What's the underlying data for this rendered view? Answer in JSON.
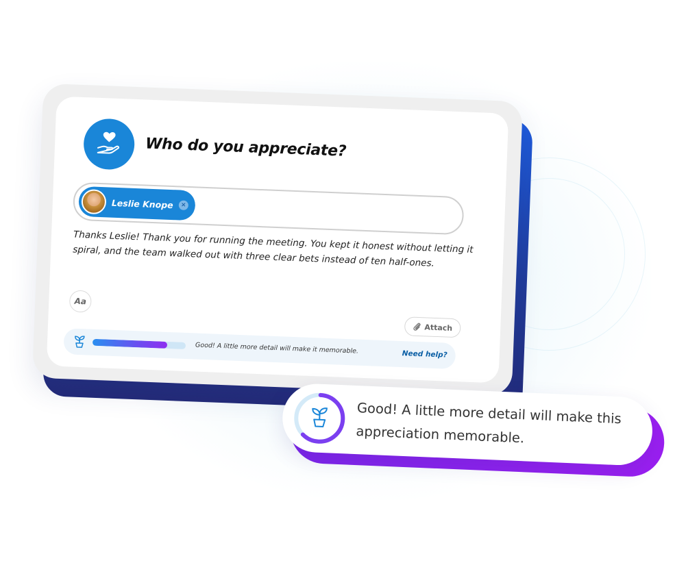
{
  "prompt": {
    "title": "Who do you appreciate?"
  },
  "recipient": {
    "name": "Leslie Knope",
    "remove_symbol": "×"
  },
  "message": {
    "text": "Thanks Leslie! Thank you for running the meeting. You kept it honest without letting it spiral, and the team walked out with three clear bets instead of ten half-ones."
  },
  "toolbar": {
    "format_label": "Aa",
    "attach_label": "Attach"
  },
  "coach": {
    "progress_fraction": 0.8,
    "text": "Good! A little more detail will make it memorable.",
    "help_label": "Need help?"
  },
  "tooltip": {
    "ring_progress_fraction": 0.62,
    "text": "Good! A little more detail will make this appreciation memorable."
  },
  "colors": {
    "brand_blue": "#1a86d8",
    "purple": "#8e2ff0",
    "navy": "#232a78"
  },
  "icons": {
    "header": "heart-hand-icon",
    "coach": "sprout-icon",
    "attach": "paperclip-icon",
    "remove": "close-circle-icon"
  }
}
